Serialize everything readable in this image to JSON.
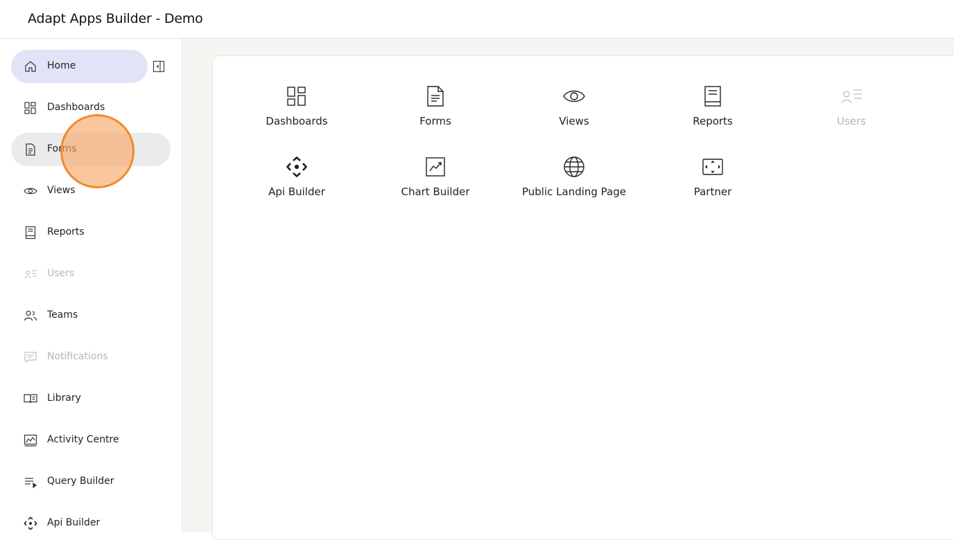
{
  "app": {
    "title": "Adapt Apps Builder - Demo"
  },
  "colors": {
    "active_nav_bg": "#e2e3f7",
    "hover_nav_bg": "#ebebeb",
    "disabled_text": "#b4b4b4",
    "cursor_ring": "#f08a2c"
  },
  "sidebar": {
    "collapse_icon": "sidebar-collapse-icon",
    "items": [
      {
        "label": "Home",
        "icon": "home-icon",
        "state": "active"
      },
      {
        "label": "Dashboards",
        "icon": "dashboard-grid-icon",
        "state": "normal"
      },
      {
        "label": "Forms",
        "icon": "document-icon",
        "state": "hover"
      },
      {
        "label": "Views",
        "icon": "eye-icon",
        "state": "normal"
      },
      {
        "label": "Reports",
        "icon": "report-icon",
        "state": "normal"
      },
      {
        "label": "Users",
        "icon": "users-icon",
        "state": "disabled"
      },
      {
        "label": "Teams",
        "icon": "team-icon",
        "state": "normal"
      },
      {
        "label": "Notifications",
        "icon": "message-icon",
        "state": "disabled"
      },
      {
        "label": "Library",
        "icon": "book-icon",
        "state": "normal"
      },
      {
        "label": "Activity Centre",
        "icon": "activity-chart-icon",
        "state": "normal"
      },
      {
        "label": "Query Builder",
        "icon": "query-list-icon",
        "state": "normal"
      },
      {
        "label": "Api Builder",
        "icon": "api-diamond-icon",
        "state": "normal"
      }
    ]
  },
  "main": {
    "tiles": [
      {
        "label": "Dashboards",
        "icon": "dashboard-grid-icon",
        "state": "normal"
      },
      {
        "label": "Forms",
        "icon": "document-icon",
        "state": "normal"
      },
      {
        "label": "Views",
        "icon": "eye-icon",
        "state": "normal"
      },
      {
        "label": "Reports",
        "icon": "report-icon",
        "state": "normal"
      },
      {
        "label": "Users",
        "icon": "users-icon",
        "state": "disabled"
      },
      {
        "label": "Api Builder",
        "icon": "api-diamond-icon",
        "state": "normal"
      },
      {
        "label": "Chart Builder",
        "icon": "chart-icon",
        "state": "normal"
      },
      {
        "label": "Public Landing Page",
        "icon": "globe-icon",
        "state": "normal"
      },
      {
        "label": "Partner",
        "icon": "partner-frame-icon",
        "state": "normal"
      }
    ]
  }
}
